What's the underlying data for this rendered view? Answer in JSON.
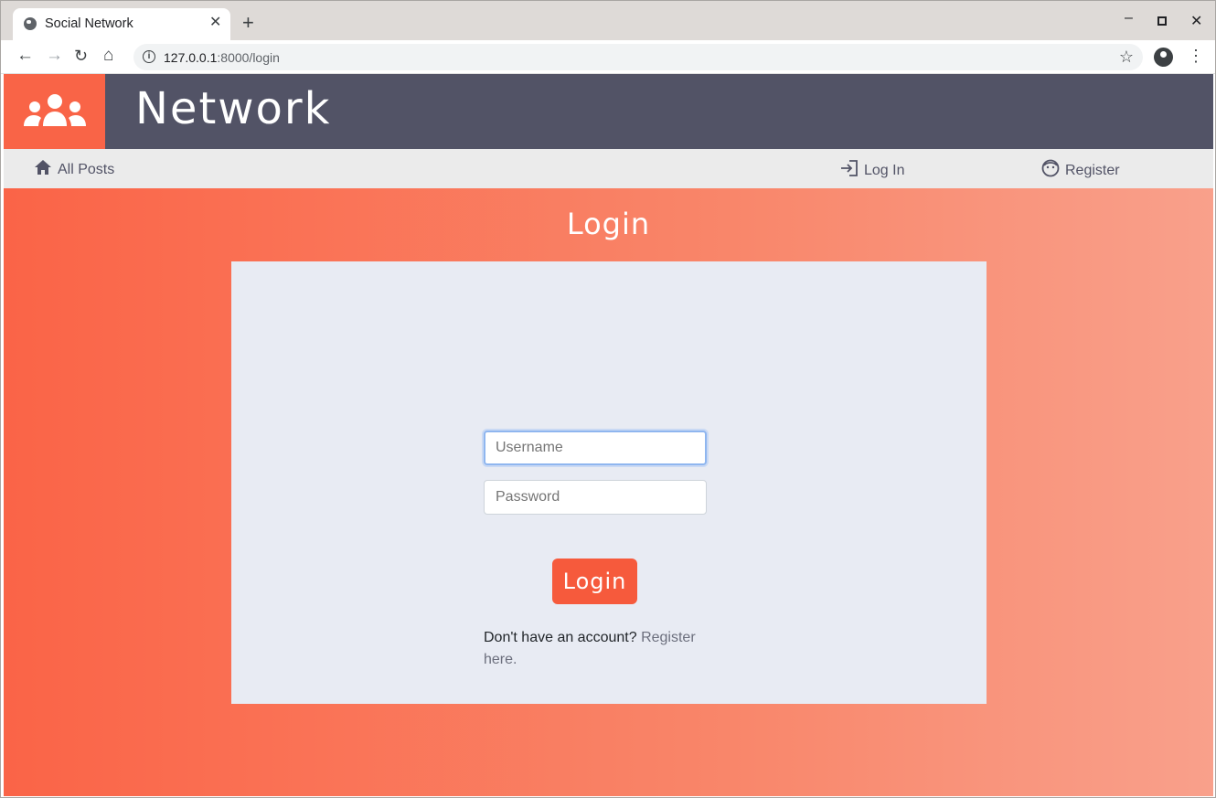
{
  "browser": {
    "tab_title": "Social Network",
    "tab_close": "✕",
    "new_tab": "+",
    "url_host": "127.0.0.1",
    "url_rest": ":8000/login",
    "info_glyph": "i",
    "star_glyph": "☆",
    "kebab_glyph": "⋮",
    "minimize_glyph": "–",
    "close_glyph": "✕",
    "back_glyph": "←",
    "forward_glyph": "→",
    "reload_glyph": "↻",
    "home_glyph": "⌂"
  },
  "header": {
    "brand": "Network",
    "logo_icon": "users-icon",
    "logo_bg": "#f96447",
    "bar_bg": "#525366"
  },
  "nav": {
    "all_posts": "All Posts",
    "log_in": "Log In",
    "register": "Register",
    "icons": [
      "home-icon",
      "sign-in-icon",
      "smile-icon"
    ]
  },
  "login": {
    "title": "Login",
    "username_placeholder": "Username",
    "password_placeholder": "Password",
    "submit_label": "Login",
    "no_account_text": "Don't have an account?",
    "register_link_text": "Register here.",
    "accent": "#f65a3c"
  }
}
